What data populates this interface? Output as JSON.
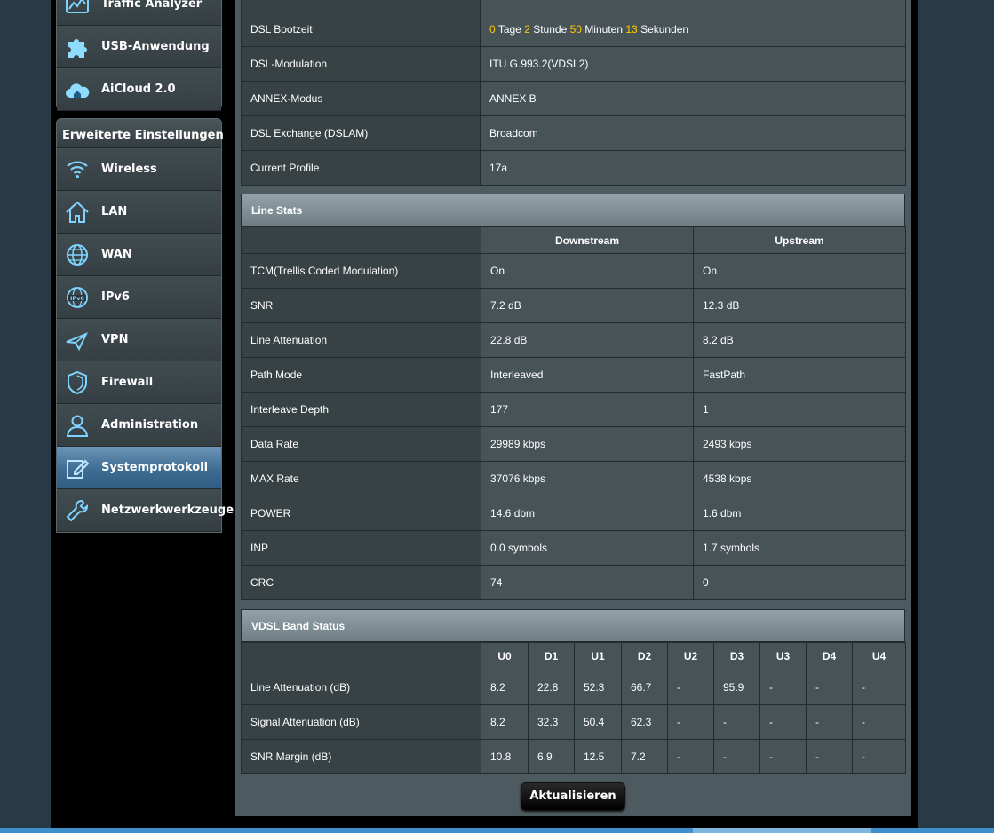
{
  "sidebar": {
    "top_items": [
      {
        "label": "Traffic Analyzer",
        "icon": "traffic-analyzer-icon"
      },
      {
        "label": "USB-Anwendung",
        "icon": "puzzle-icon"
      },
      {
        "label": "AiCloud 2.0",
        "icon": "cloud-home-icon"
      }
    ],
    "advanced_header": "Erweiterte Einstellungen",
    "advanced_items": [
      {
        "label": "Wireless",
        "icon": "wifi-icon"
      },
      {
        "label": "LAN",
        "icon": "home-icon"
      },
      {
        "label": "WAN",
        "icon": "globe-icon"
      },
      {
        "label": "IPv6",
        "icon": "ipv6-globe-icon"
      },
      {
        "label": "VPN",
        "icon": "vpn-icon"
      },
      {
        "label": "Firewall",
        "icon": "shield-icon"
      },
      {
        "label": "Administration",
        "icon": "user-icon"
      },
      {
        "label": "Systemprotokoll",
        "icon": "edit-log-icon",
        "active": true
      },
      {
        "label": "Netzwerkwerkzeuge",
        "icon": "wrench-icon"
      }
    ]
  },
  "dsl_info": {
    "rows": [
      {
        "label": "DSL Bootzeit",
        "uptime": {
          "days": "0",
          "days_unit": "Tage",
          "hours": "2",
          "hours_unit": "Stunde",
          "minutes": "50",
          "minutes_unit": "Minuten",
          "seconds": "13",
          "seconds_unit": "Sekunden"
        }
      },
      {
        "label": "DSL-Modulation",
        "value": "ITU G.993.2(VDSL2)"
      },
      {
        "label": "ANNEX-Modus",
        "value": "ANNEX B"
      },
      {
        "label": "DSL Exchange (DSLAM)",
        "value": "Broadcom"
      },
      {
        "label": "Current Profile",
        "value": "17a"
      }
    ]
  },
  "line_stats": {
    "title": "Line Stats",
    "col_downstream": "Downstream",
    "col_upstream": "Upstream",
    "rows": [
      {
        "label": "TCM(Trellis Coded Modulation)",
        "down": "On",
        "up": "On"
      },
      {
        "label": "SNR",
        "down": "7.2 dB",
        "up": "12.3 dB"
      },
      {
        "label": "Line Attenuation",
        "down": "22.8 dB",
        "up": "8.2 dB"
      },
      {
        "label": "Path Mode",
        "down": "Interleaved",
        "up": "FastPath"
      },
      {
        "label": "Interleave Depth",
        "down": "177",
        "up": "1"
      },
      {
        "label": "Data Rate",
        "down": "29989 kbps",
        "up": "2493 kbps"
      },
      {
        "label": "MAX Rate",
        "down": "37076 kbps",
        "up": "4538 kbps"
      },
      {
        "label": "POWER",
        "down": "14.6 dbm",
        "up": "1.6 dbm"
      },
      {
        "label": "INP",
        "down": "0.0 symbols",
        "up": "1.7 symbols"
      },
      {
        "label": "CRC",
        "down": "74",
        "up": "0"
      }
    ]
  },
  "vdsl_band": {
    "title": "VDSL Band Status",
    "bands": [
      "U0",
      "D1",
      "U1",
      "D2",
      "U2",
      "D3",
      "U3",
      "D4",
      "U4"
    ],
    "rows": [
      {
        "label": "Line Attenuation (dB)",
        "values": [
          "8.2",
          "22.8",
          "52.3",
          "66.7",
          "-",
          "95.9",
          "-",
          "-",
          "-"
        ]
      },
      {
        "label": "Signal Attenuation (dB)",
        "values": [
          "8.2",
          "32.3",
          "50.4",
          "62.3",
          "-",
          "-",
          "-",
          "-",
          "-"
        ]
      },
      {
        "label": "SNR Margin (dB)",
        "values": [
          "10.8",
          "6.9",
          "12.5",
          "7.2",
          "-",
          "-",
          "-",
          "-",
          "-"
        ]
      }
    ]
  },
  "colors": {
    "upstream_value": "#3fb1f5",
    "downstream_value": "#f28a2e",
    "uptime_number": "#ffcc00",
    "active_menu": "#3e6d93"
  },
  "refresh_label": "Aktualisieren"
}
